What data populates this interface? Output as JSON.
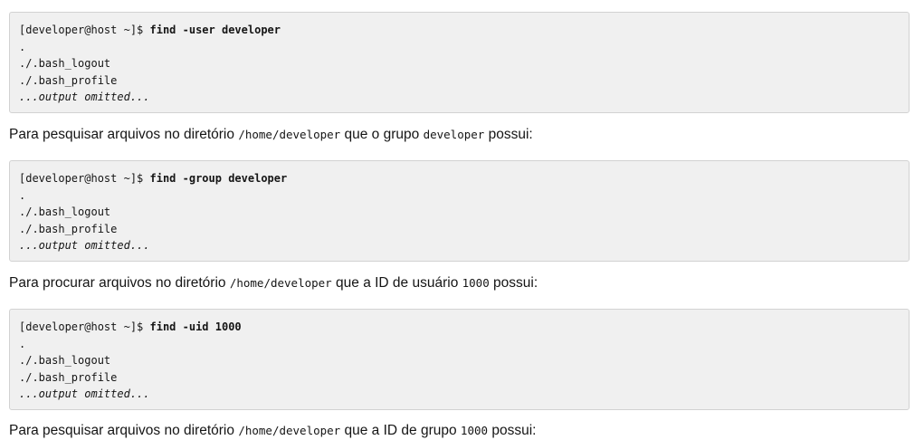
{
  "blocks": [
    {
      "prompt": "[developer@host ~]$ ",
      "command": "find -user developer",
      "lines": [
        ".",
        "./.bash_logout",
        "./.bash_profile"
      ],
      "omitted": "...output omitted..."
    },
    {
      "prompt": "[developer@host ~]$ ",
      "command": "find -group developer",
      "lines": [
        ".",
        "./.bash_logout",
        "./.bash_profile"
      ],
      "omitted": "...output omitted..."
    },
    {
      "prompt": "[developer@host ~]$ ",
      "command": "find -uid 1000",
      "lines": [
        ".",
        "./.bash_logout",
        "./.bash_profile"
      ],
      "omitted": "...output omitted..."
    }
  ],
  "paragraphs": [
    {
      "part1": "Para pesquisar arquivos no diretório ",
      "code1": "/home/developer",
      "part2": " que o grupo ",
      "code2": "developer",
      "part3": " possui:"
    },
    {
      "part1": "Para procurar arquivos no diretório ",
      "code1": "/home/developer",
      "part2": " que a ID de usuário ",
      "code2": "1000",
      "part3": " possui:"
    },
    {
      "part1": "Para pesquisar arquivos no diretório ",
      "code1": "/home/developer",
      "part2": " que a ID de grupo ",
      "code2": "1000",
      "part3": " possui:"
    }
  ]
}
